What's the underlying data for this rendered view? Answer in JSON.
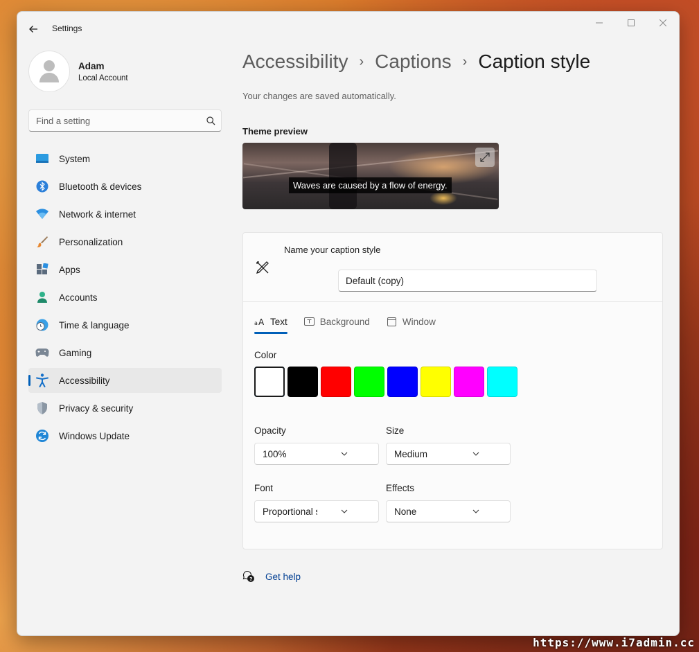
{
  "window": {
    "app_title": "Settings",
    "controls": [
      "minimize",
      "maximize",
      "close"
    ]
  },
  "profile": {
    "name": "Adam",
    "account": "Local Account"
  },
  "search": {
    "placeholder": "Find a setting"
  },
  "sidebar": {
    "items": [
      {
        "label": "System",
        "icon": "system-icon"
      },
      {
        "label": "Bluetooth & devices",
        "icon": "bluetooth-icon"
      },
      {
        "label": "Network & internet",
        "icon": "wifi-icon"
      },
      {
        "label": "Personalization",
        "icon": "brush-icon"
      },
      {
        "label": "Apps",
        "icon": "apps-icon"
      },
      {
        "label": "Accounts",
        "icon": "accounts-icon"
      },
      {
        "label": "Time & language",
        "icon": "clock-globe-icon"
      },
      {
        "label": "Gaming",
        "icon": "gamepad-icon"
      },
      {
        "label": "Accessibility",
        "icon": "accessibility-icon",
        "active": true
      },
      {
        "label": "Privacy & security",
        "icon": "shield-icon"
      },
      {
        "label": "Windows Update",
        "icon": "update-icon"
      }
    ]
  },
  "breadcrumb": [
    "Accessibility",
    "Captions",
    "Caption style"
  ],
  "autosave_note": "Your changes are saved automatically.",
  "preview": {
    "label": "Theme preview",
    "caption_text": "Waves are caused by a flow of energy."
  },
  "style_card": {
    "name_label": "Name your caption style",
    "name_value": "Default (copy)",
    "tabs": [
      {
        "label": "Text",
        "icon": "text-size-icon",
        "active": true
      },
      {
        "label": "Background",
        "icon": "text-background-icon"
      },
      {
        "label": "Window",
        "icon": "window-icon"
      }
    ],
    "color_label": "Color",
    "colors": [
      "#ffffff",
      "#000000",
      "#ff0000",
      "#00ff00",
      "#0000ff",
      "#ffff00",
      "#ff00ff",
      "#00ffff"
    ],
    "selected_color": "#ffffff",
    "opacity": {
      "label": "Opacity",
      "value": "100%"
    },
    "size": {
      "label": "Size",
      "value": "Medium"
    },
    "font": {
      "label": "Font",
      "value": "Proportional sans s..."
    },
    "effects": {
      "label": "Effects",
      "value": "None"
    }
  },
  "help": {
    "label": "Get help"
  },
  "accent_color": "#005fb8",
  "watermark": "https://www.i7admin.cc"
}
